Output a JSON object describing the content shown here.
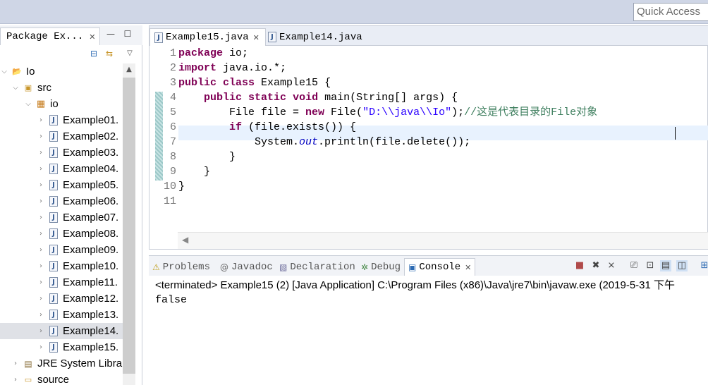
{
  "quick_access": {
    "placeholder": "Quick Access"
  },
  "package_explorer": {
    "tab_label": "Package Ex...",
    "tree": [
      {
        "label": "Io",
        "level": 0,
        "expanded": true,
        "icon": "project-icon"
      },
      {
        "label": "src",
        "level": 1,
        "expanded": true,
        "icon": "source-folder-icon"
      },
      {
        "label": "io",
        "level": 2,
        "expanded": true,
        "icon": "package-icon"
      },
      {
        "label": "Example01.",
        "level": 3,
        "icon": "java-file-icon"
      },
      {
        "label": "Example02.",
        "level": 3,
        "icon": "java-file-icon"
      },
      {
        "label": "Example03.",
        "level": 3,
        "icon": "java-file-icon"
      },
      {
        "label": "Example04.",
        "level": 3,
        "icon": "java-file-icon"
      },
      {
        "label": "Example05.",
        "level": 3,
        "icon": "java-file-icon"
      },
      {
        "label": "Example06.",
        "level": 3,
        "icon": "java-file-icon"
      },
      {
        "label": "Example07.",
        "level": 3,
        "icon": "java-file-icon"
      },
      {
        "label": "Example08.",
        "level": 3,
        "icon": "java-file-icon"
      },
      {
        "label": "Example09.",
        "level": 3,
        "icon": "java-file-icon"
      },
      {
        "label": "Example10.",
        "level": 3,
        "icon": "java-file-icon"
      },
      {
        "label": "Example11.",
        "level": 3,
        "icon": "java-file-icon"
      },
      {
        "label": "Example12.",
        "level": 3,
        "icon": "java-file-icon"
      },
      {
        "label": "Example13.",
        "level": 3,
        "icon": "java-file-icon"
      },
      {
        "label": "Example14.",
        "level": 3,
        "icon": "java-file-icon",
        "selected": true
      },
      {
        "label": "Example15.",
        "level": 3,
        "icon": "java-file-icon"
      },
      {
        "label": "JRE System Libra",
        "level": 1,
        "icon": "library-icon"
      },
      {
        "label": "source",
        "level": 1,
        "icon": "folder-icon"
      }
    ]
  },
  "editor": {
    "tabs": [
      {
        "label": "Example15.java",
        "active": true
      },
      {
        "label": "Example14.java",
        "active": false
      }
    ],
    "line_numbers": [
      "1",
      "2",
      "3",
      "4",
      "5",
      "6",
      "7",
      "8",
      "9",
      "10",
      "11"
    ],
    "code": {
      "l1_kw": "package",
      "l1_rest": " io;",
      "l2_kw": "import",
      "l2_rest": " java.io.*;",
      "l3_kw1": "public",
      "l3_kw2": "class",
      "l3_rest": " Example15 {",
      "l4_indent": "    ",
      "l4_kw1": "public",
      "l4_kw2": "static",
      "l4_kw3": "void",
      "l4_rest": " main(String[] args) {",
      "l5_a": "        File file = ",
      "l5_kw": "new",
      "l5_b": " File(",
      "l5_str": "\"D:\\\\java\\\\Io\"",
      "l5_c": ");",
      "l5_cm": "//这是代表目录的File对象",
      "l6_indent": "        ",
      "l6_kw": "if",
      "l6_rest": " (file.exists()) {",
      "l7_a": "            System.",
      "l7_fld": "out",
      "l7_b": ".println(file.delete());",
      "l8": "        }",
      "l9": "    }",
      "l10": "}",
      "l11": ""
    }
  },
  "console": {
    "tabs": [
      {
        "label": "Problems",
        "icon": "problems-icon"
      },
      {
        "label": "Javadoc",
        "icon": "javadoc-icon"
      },
      {
        "label": "Declaration",
        "icon": "declaration-icon"
      },
      {
        "label": "Debug",
        "icon": "debug-icon"
      },
      {
        "label": "Console",
        "icon": "console-icon",
        "active": true
      }
    ],
    "terminated_line": "<terminated> Example15 (2) [Java Application] C:\\Program Files (x86)\\Java\\jre7\\bin\\javaw.exe (2019-5-31 下午",
    "output": "false"
  },
  "colors": {
    "keyword": "#7f0055",
    "string": "#2a00ff",
    "comment": "#3f7f5f",
    "field": "#0000c0",
    "selection": "#dfe1e6"
  }
}
